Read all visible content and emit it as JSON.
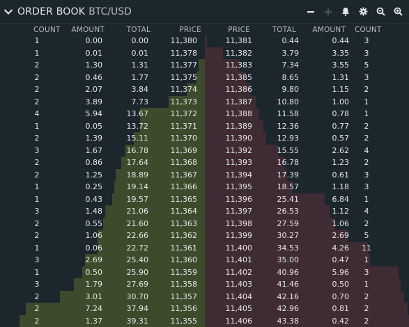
{
  "header": {
    "title": "ORDER BOOK",
    "pair": "BTC/USD",
    "tools": [
      "minus-icon",
      "plus-icon",
      "bell-icon",
      "gear-icon",
      "zoom-out-icon",
      "zoom-in-icon"
    ]
  },
  "columns": {
    "bids": [
      "COUNT",
      "AMOUNT",
      "TOTAL",
      "PRICE"
    ],
    "asks": [
      "PRICE",
      "TOTAL",
      "AMOUNT",
      "COUNT"
    ]
  },
  "colors": {
    "bid_bar": "#3b4b2b",
    "ask_bar": "#3f2b33",
    "background": "#1b262d"
  },
  "max_total": 43.38,
  "bids": [
    {
      "count": "1",
      "amount": "0.00",
      "total": "0.00",
      "price": "11,380"
    },
    {
      "count": "1",
      "amount": "0.01",
      "total": "0.01",
      "price": "11,378"
    },
    {
      "count": "2",
      "amount": "1.30",
      "total": "1.31",
      "price": "11,377"
    },
    {
      "count": "2",
      "amount": "0.46",
      "total": "1.77",
      "price": "11,375"
    },
    {
      "count": "2",
      "amount": "2.07",
      "total": "3.84",
      "price": "11,374"
    },
    {
      "count": "2",
      "amount": "3.89",
      "total": "7.73",
      "price": "11,373"
    },
    {
      "count": "4",
      "amount": "5.94",
      "total": "13.67",
      "price": "11,372"
    },
    {
      "count": "1",
      "amount": "0.05",
      "total": "13.72",
      "price": "11,371"
    },
    {
      "count": "2",
      "amount": "1.39",
      "total": "15.11",
      "price": "11,370"
    },
    {
      "count": "3",
      "amount": "1.67",
      "total": "16.78",
      "price": "11,369"
    },
    {
      "count": "2",
      "amount": "0.86",
      "total": "17.64",
      "price": "11,368"
    },
    {
      "count": "2",
      "amount": "1.25",
      "total": "18.89",
      "price": "11,367"
    },
    {
      "count": "1",
      "amount": "0.25",
      "total": "19.14",
      "price": "11,366"
    },
    {
      "count": "1",
      "amount": "0.43",
      "total": "19.57",
      "price": "11,365"
    },
    {
      "count": "3",
      "amount": "1.48",
      "total": "21.06",
      "price": "11,364"
    },
    {
      "count": "2",
      "amount": "0.55",
      "total": "21.60",
      "price": "11,363"
    },
    {
      "count": "2",
      "amount": "1.06",
      "total": "22.66",
      "price": "11,362"
    },
    {
      "count": "1",
      "amount": "0.06",
      "total": "22.72",
      "price": "11,361"
    },
    {
      "count": "3",
      "amount": "2.69",
      "total": "25.40",
      "price": "11,360"
    },
    {
      "count": "1",
      "amount": "0.50",
      "total": "25.90",
      "price": "11,359"
    },
    {
      "count": "3",
      "amount": "1.79",
      "total": "27.69",
      "price": "11,358"
    },
    {
      "count": "2",
      "amount": "3.01",
      "total": "30.70",
      "price": "11,357"
    },
    {
      "count": "2",
      "amount": "7.24",
      "total": "37.94",
      "price": "11,356"
    },
    {
      "count": "2",
      "amount": "1.37",
      "total": "39.31",
      "price": "11,355"
    }
  ],
  "asks": [
    {
      "price": "11,381",
      "total": "0.44",
      "amount": "0.44",
      "count": "3"
    },
    {
      "price": "11,382",
      "total": "3.79",
      "amount": "3.35",
      "count": "3"
    },
    {
      "price": "11,383",
      "total": "7.34",
      "amount": "3.55",
      "count": "5"
    },
    {
      "price": "11,385",
      "total": "8.65",
      "amount": "1.31",
      "count": "3"
    },
    {
      "price": "11,386",
      "total": "9.80",
      "amount": "1.15",
      "count": "2"
    },
    {
      "price": "11,387",
      "total": "10.80",
      "amount": "1.00",
      "count": "1"
    },
    {
      "price": "11,388",
      "total": "11.58",
      "amount": "0.78",
      "count": "1"
    },
    {
      "price": "11,389",
      "total": "12.36",
      "amount": "0.77",
      "count": "2"
    },
    {
      "price": "11,390",
      "total": "12.93",
      "amount": "0.57",
      "count": "2"
    },
    {
      "price": "11,392",
      "total": "15.55",
      "amount": "2.62",
      "count": "4"
    },
    {
      "price": "11,393",
      "total": "16.78",
      "amount": "1.23",
      "count": "2"
    },
    {
      "price": "11,394",
      "total": "17.39",
      "amount": "0.61",
      "count": "3"
    },
    {
      "price": "11,395",
      "total": "18.57",
      "amount": "1.18",
      "count": "3"
    },
    {
      "price": "11,396",
      "total": "25.41",
      "amount": "6.84",
      "count": "1"
    },
    {
      "price": "11,397",
      "total": "26.53",
      "amount": "1.12",
      "count": "4"
    },
    {
      "price": "11,398",
      "total": "27.59",
      "amount": "1.06",
      "count": "2"
    },
    {
      "price": "11,399",
      "total": "30.27",
      "amount": "2.69",
      "count": "5"
    },
    {
      "price": "11,400",
      "total": "34.53",
      "amount": "4.26",
      "count": "11"
    },
    {
      "price": "11,401",
      "total": "35.00",
      "amount": "0.47",
      "count": "1"
    },
    {
      "price": "11,402",
      "total": "40.96",
      "amount": "5.96",
      "count": "3"
    },
    {
      "price": "11,403",
      "total": "41.46",
      "amount": "0.50",
      "count": "1"
    },
    {
      "price": "11,404",
      "total": "42.16",
      "amount": "0.70",
      "count": "2"
    },
    {
      "price": "11,405",
      "total": "42.96",
      "amount": "0.81",
      "count": "2"
    },
    {
      "price": "11,406",
      "total": "43.38",
      "amount": "0.42",
      "count": "2"
    }
  ]
}
